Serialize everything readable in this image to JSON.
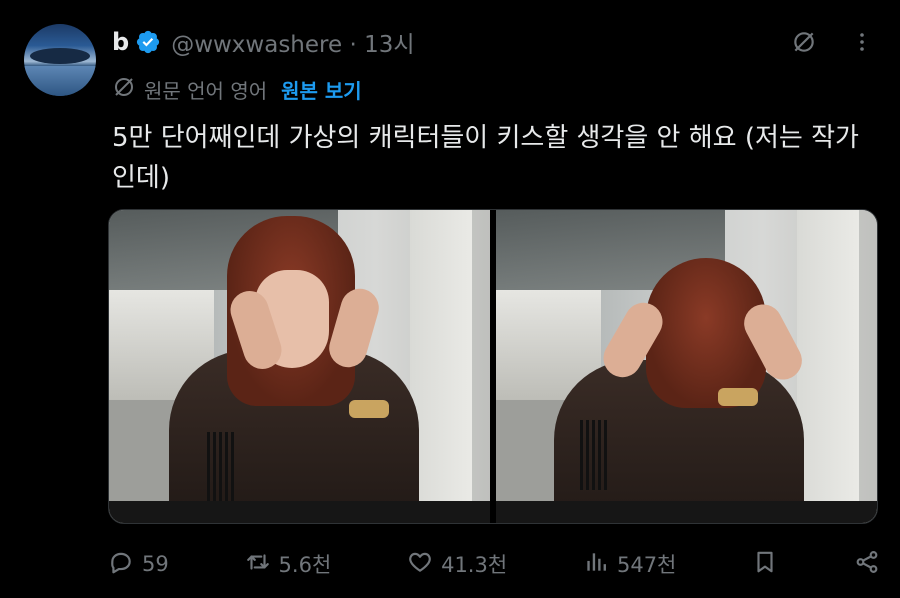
{
  "tweet": {
    "display_name": "b",
    "handle": "@wwxwashere",
    "separator": "·",
    "time_ago": "13시",
    "translation": {
      "label": "원문 언어 영어",
      "show_original": "원본 보기"
    },
    "text": "5만 단어째인데 가상의 캐릭터들이 키스할 생각을 안 해요 (저는 작가인데)",
    "metrics": {
      "replies": "59",
      "reposts": "5.6천",
      "likes": "41.3천",
      "views": "547천"
    }
  },
  "colors": {
    "background": "#000000",
    "primary_text": "#e7e9ea",
    "secondary_text": "#71767b",
    "accent": "#1d9bf0",
    "verified": "#1d9bf0"
  },
  "icons": [
    "verified-badge-icon",
    "hide-translation-icon",
    "more-icon",
    "translate-icon",
    "reply-icon",
    "repost-icon",
    "like-icon",
    "views-icon",
    "bookmark-icon",
    "share-icon"
  ]
}
